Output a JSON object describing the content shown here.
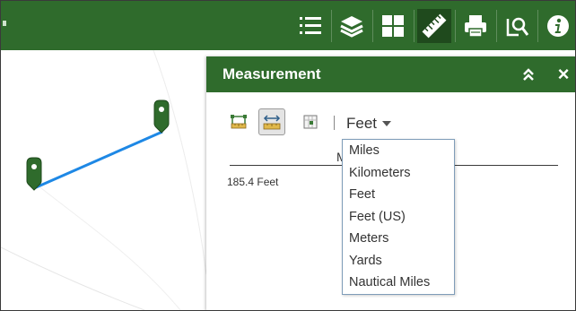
{
  "toolbar": {
    "background": "#2f6b2c",
    "active_background": "#1f4a1d",
    "tools": [
      {
        "icon": "legend-icon",
        "active": false
      },
      {
        "icon": "layers-icon",
        "active": false
      },
      {
        "icon": "basemap-gallery-icon",
        "active": false
      },
      {
        "icon": "measurement-ruler-icon",
        "active": true
      },
      {
        "icon": "print-icon",
        "active": false
      },
      {
        "icon": "query-icon",
        "active": false
      },
      {
        "icon": "info-icon",
        "active": false
      }
    ]
  },
  "panel": {
    "title": "Measurement",
    "collapse_icon": "double-chevron-up-icon",
    "close_icon": "close-icon",
    "close_label": "×",
    "tools": [
      {
        "icon": "area-measure-icon",
        "active": false
      },
      {
        "icon": "distance-measure-icon",
        "active": true
      },
      {
        "icon": "location-measure-icon",
        "active": false
      }
    ],
    "separator": "|",
    "unit_selected": "Feet",
    "result_header": "M",
    "result_value": "185.4 Feet"
  },
  "dropdown": {
    "options": [
      "Miles",
      "Kilometers",
      "Feet",
      "Feet (US)",
      "Meters",
      "Yards",
      "Nautical Miles"
    ]
  },
  "colors": {
    "header_green": "#2f6b2c",
    "measure_line": "#1e88e5",
    "marker_green": "#2f6b2c"
  }
}
